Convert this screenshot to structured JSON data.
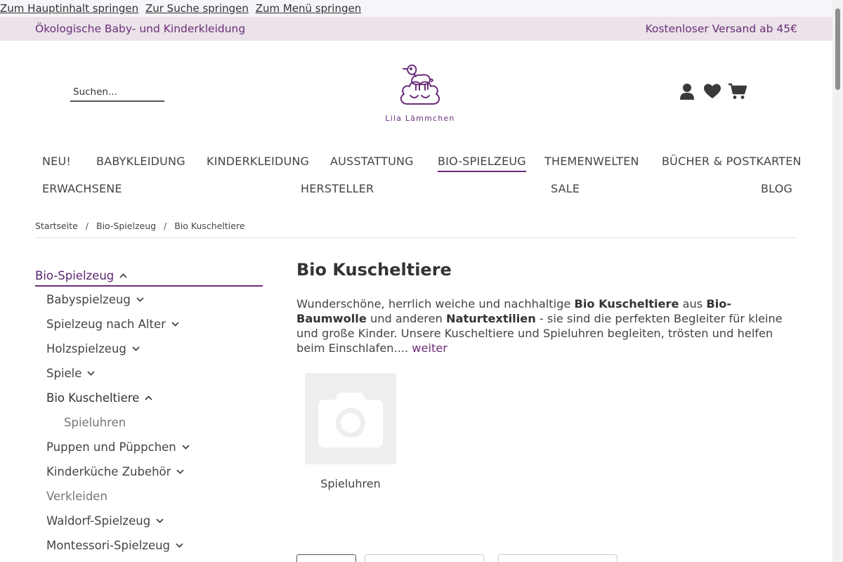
{
  "skip_links": [
    "Zum Hauptinhalt springen",
    "Zur Suche springen",
    "Zum Menü springen"
  ],
  "topbar": {
    "left": "Ökologische Baby- und Kinderkleidung",
    "right": "Kostenloser Versand ab 45€"
  },
  "search": {
    "placeholder": "Suchen..."
  },
  "logo": {
    "text": "Lila Lämmchen",
    "icon": "lamb-on-cloud-logo"
  },
  "header_icons": [
    "user-icon",
    "heart-icon",
    "cart-icon"
  ],
  "colors": {
    "brand": "#6b2d7a",
    "topbar_bg": "#ebe2ea",
    "text": "#444444"
  },
  "nav": {
    "row1": [
      "NEU!",
      "BABYKLEIDUNG",
      "KINDERKLEIDUNG",
      "AUSSTATTUNG",
      "BIO-SPIELZEUG",
      "THEMENWELTEN",
      "BÜCHER & POSTKARTEN"
    ],
    "row2": [
      "ERWACHSENE",
      "HERSTELLER",
      "SALE",
      "BLOG"
    ],
    "active": "BIO-SPIELZEUG"
  },
  "breadcrumb": [
    "Startseite",
    "Bio-Spielzeug",
    "Bio Kuscheltiere"
  ],
  "sidebar": {
    "heading": "Bio-Spielzeug",
    "items": [
      "Babyspielzeug",
      "Spielzeug nach Alter",
      "Holzspielzeug",
      "Spiele",
      "Bio Kuscheltiere",
      "Spieluhren",
      "Puppen und Püppchen",
      "Kinderküche Zubehör",
      "Verkleiden",
      "Waldorf-Spielzeug",
      "Montessori-Spielzeug"
    ]
  },
  "content": {
    "title": "Bio Kuscheltiere",
    "desc": {
      "p1": "Wunderschöne, herrlich weiche und nachhaltige ",
      "b1": "Bio Kuscheltiere",
      "p2": " aus ",
      "b2": "Bio-Baumwolle",
      "p3": " und anderen ",
      "b3": "Naturtextilien",
      "p4": "  - sie sind die perfekten Begleiter für kleine und große Kinder. Unsere Kuscheltiere und Spieluhren begleiten, trösten und helfen beim Einschlafen.... ",
      "more": "weiter"
    },
    "subcategory": {
      "label": "Spieluhren",
      "icon": "camera-placeholder-icon"
    }
  }
}
